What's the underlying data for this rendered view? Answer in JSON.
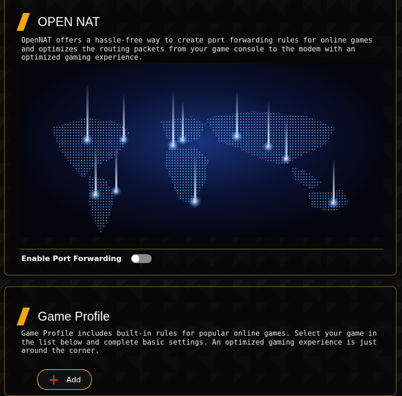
{
  "open_nat": {
    "title": "OPEN NAT",
    "description": "OpenNAT offers a hassle-free way to create port forwarding rules for online games and optimizes the routing packets from your game console to the modem with an optimized gaming experience.",
    "enable_label": "Enable Port Forwarding",
    "enabled": false
  },
  "game_profile": {
    "title": "Game Profile",
    "description": "Game Profile includes built-in rules for popular online games. Select your game in the list below and complete basic settings. An optimized gaming experience is just around the corner.",
    "add_label": "Add"
  },
  "colors": {
    "accent": "#f2a614",
    "border": "#6b5320",
    "plus": "#e0463b"
  }
}
